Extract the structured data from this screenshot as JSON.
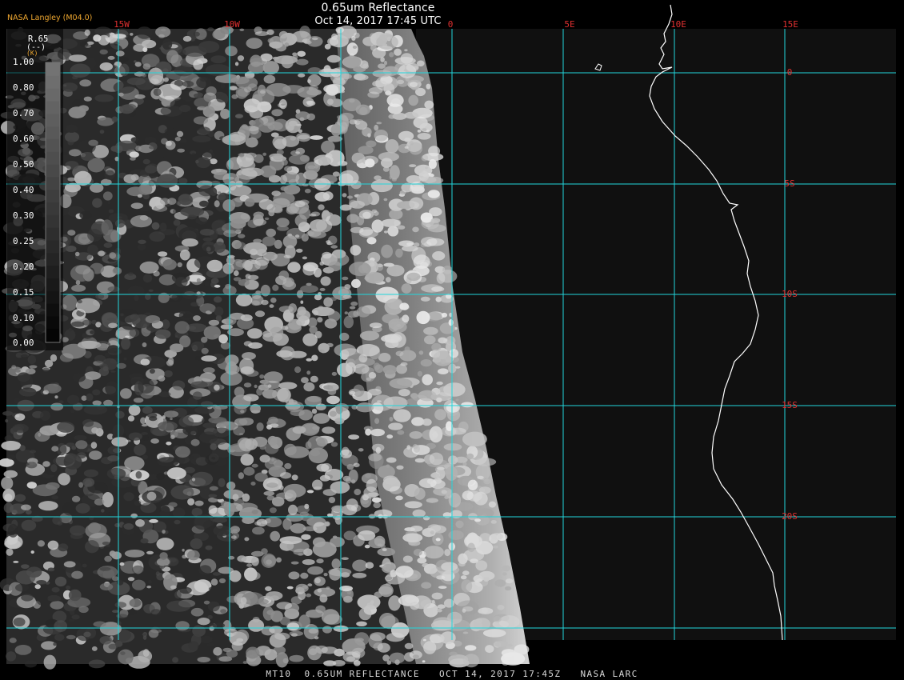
{
  "header": {
    "title": "0.65um Reflectance",
    "subtitle": "Oct 14, 2017 17:45 UTC",
    "source": "NASA Langley (M04.0)"
  },
  "footer": {
    "caption": "MT10  0.65UM REFLECTANCE   OCT 14, 2017 17:45Z   NASA LARC"
  },
  "legend": {
    "title": "R.65",
    "units": "(--)",
    "marker": "(K)",
    "ticks": [
      "1.00",
      "0.80",
      "0.70",
      "0.60",
      "0.50",
      "0.40",
      "0.30",
      "0.25",
      "0.20",
      "0.15",
      "0.10",
      "0.00"
    ]
  },
  "map": {
    "longitude_labels": [
      "15W",
      "10W",
      "0",
      "5E",
      "10E",
      "15E"
    ],
    "latitude_labels": [
      "0",
      "5S",
      "10S",
      "15S",
      "20S"
    ],
    "colors": {
      "grid": "#22d6dc",
      "grid_label": "#e03030",
      "coastline": "#ffffff",
      "ocean_dark": "#141414"
    }
  }
}
